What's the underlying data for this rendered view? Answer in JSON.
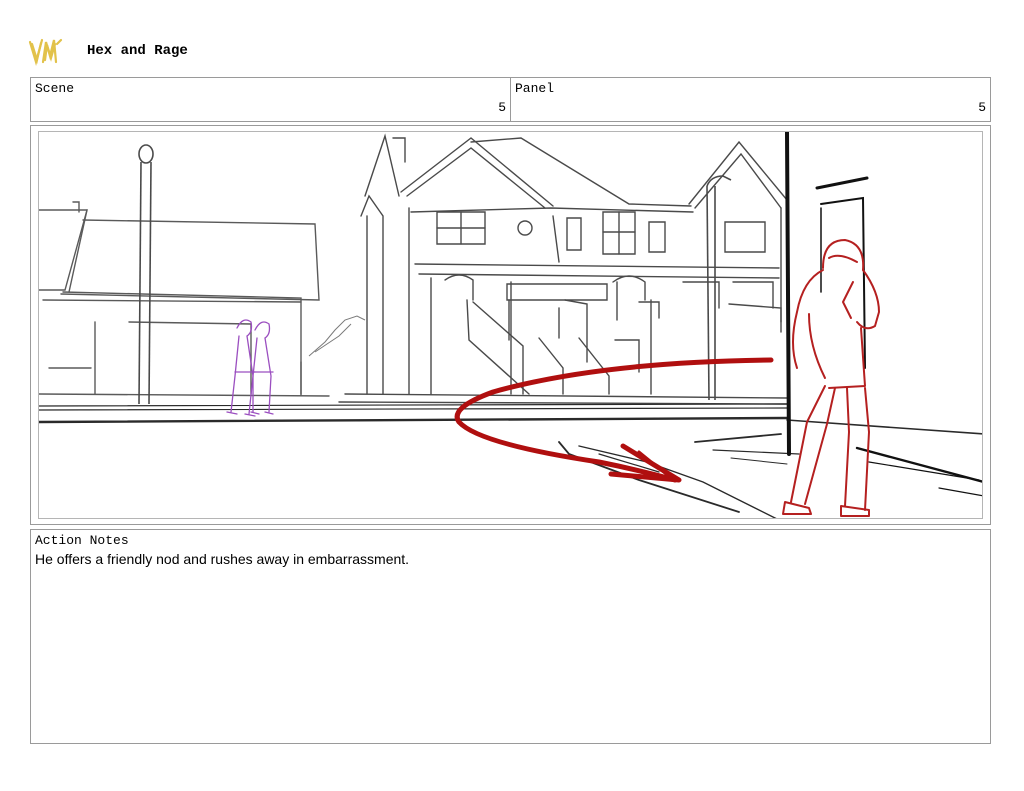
{
  "header": {
    "logo_icon": "vm-logo-icon",
    "logo_color": "#E2C24A",
    "title": "Hex and Rage"
  },
  "info": {
    "scene_label": "Scene",
    "scene_value": "5",
    "panel_label": "Panel",
    "panel_value": "5"
  },
  "drawing": {
    "sketch_color": "#3a3a3a",
    "girls_color": "#9B4FC0",
    "hooded_figure_color": "#B52020",
    "motion_arrow_color": "#B00F0F"
  },
  "notes": {
    "label": "Action Notes",
    "text": "He offers a friendly nod and rushes away in embarrassment."
  }
}
